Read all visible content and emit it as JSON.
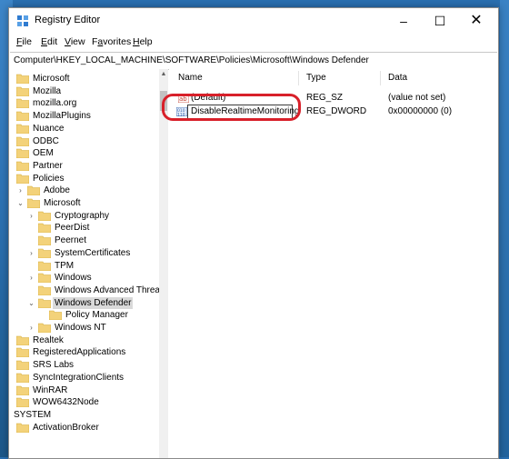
{
  "window": {
    "title": "Registry Editor",
    "minimize": "–",
    "maximize": "☐",
    "close": "✕"
  },
  "menu": [
    {
      "key": "F",
      "rest": "ile"
    },
    {
      "key": "E",
      "rest": "dit"
    },
    {
      "key": "V",
      "rest": "iew"
    },
    {
      "key": "F",
      "pre": "F",
      "rest": "avorites"
    },
    {
      "key": "H",
      "rest": "elp"
    }
  ],
  "address": "Computer\\HKEY_LOCAL_MACHINE\\SOFTWARE\\Policies\\Microsoft\\Windows Defender",
  "tree": [
    {
      "label": "Microsoft",
      "level": 0,
      "expander": ""
    },
    {
      "label": "Mozilla",
      "level": 0,
      "expander": ""
    },
    {
      "label": "mozilla.org",
      "level": 0,
      "expander": ""
    },
    {
      "label": "MozillaPlugins",
      "level": 0,
      "expander": ""
    },
    {
      "label": "Nuance",
      "level": 0,
      "expander": ""
    },
    {
      "label": "ODBC",
      "level": 0,
      "expander": ""
    },
    {
      "label": "OEM",
      "level": 0,
      "expander": ""
    },
    {
      "label": "Partner",
      "level": 0,
      "expander": ""
    },
    {
      "label": "Policies",
      "level": 0,
      "expander": ""
    },
    {
      "label": "Adobe",
      "level": 1,
      "expander": ">"
    },
    {
      "label": "Microsoft",
      "level": 1,
      "expander": "v"
    },
    {
      "label": "Cryptography",
      "level": 2,
      "expander": ">"
    },
    {
      "label": "PeerDist",
      "level": 2,
      "expander": ""
    },
    {
      "label": "Peernet",
      "level": 2,
      "expander": ""
    },
    {
      "label": "SystemCertificates",
      "level": 2,
      "expander": ">"
    },
    {
      "label": "TPM",
      "level": 2,
      "expander": ""
    },
    {
      "label": "Windows",
      "level": 2,
      "expander": ">"
    },
    {
      "label": "Windows Advanced Threa",
      "level": 2,
      "expander": ""
    },
    {
      "label": "Windows Defender",
      "level": 2,
      "expander": "v",
      "selected": true
    },
    {
      "label": "Policy Manager",
      "level": 3,
      "expander": ""
    },
    {
      "label": "Windows NT",
      "level": 2,
      "expander": ">"
    },
    {
      "label": "Realtek",
      "level": 0,
      "expander": ""
    },
    {
      "label": "RegisteredApplications",
      "level": 0,
      "expander": ""
    },
    {
      "label": "SRS Labs",
      "level": 0,
      "expander": ""
    },
    {
      "label": "SyncIntegrationClients",
      "level": 0,
      "expander": ""
    },
    {
      "label": "WinRAR",
      "level": 0,
      "expander": ""
    },
    {
      "label": "WOW6432Node",
      "level": 0,
      "expander": ""
    },
    {
      "label": "SYSTEM",
      "level": -1,
      "expander": ""
    },
    {
      "label": "ActivationBroker",
      "level": 0,
      "expander": ""
    }
  ],
  "columns": {
    "name": "Name",
    "type": "Type",
    "data": "Data"
  },
  "values": [
    {
      "name": "(Default)",
      "type": "REG_SZ",
      "data": "(value not set)",
      "icon": "string-value-icon"
    },
    {
      "name": "DisableRealtimeMonitoring",
      "type": "REG_DWORD",
      "data": "0x00000000 (0)",
      "icon": "dword-value-icon",
      "editing": true
    }
  ],
  "colors": {
    "accent": "#d8202a",
    "folder": "#f3d27a",
    "selection": "#d9d9d9"
  }
}
